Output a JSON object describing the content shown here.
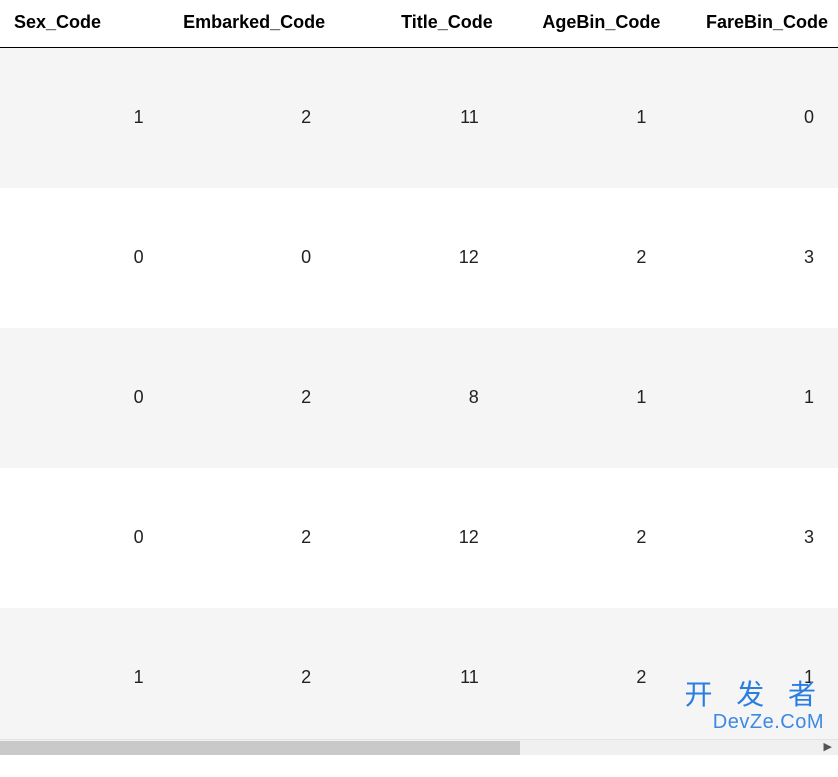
{
  "chart_data": {
    "type": "table",
    "columns": [
      "Sex_Code",
      "Embarked_Code",
      "Title_Code",
      "AgeBin_Code",
      "FareBin_Code"
    ],
    "rows": [
      [
        1,
        2,
        11,
        1,
        0
      ],
      [
        0,
        0,
        12,
        2,
        3
      ],
      [
        0,
        2,
        8,
        1,
        1
      ],
      [
        0,
        2,
        12,
        2,
        3
      ],
      [
        1,
        2,
        11,
        2,
        1
      ]
    ]
  },
  "headers": {
    "c0": "Sex_Code",
    "c1": "Embarked_Code",
    "c2": "Title_Code",
    "c3": "AgeBin_Code",
    "c4": "FareBin_Code"
  },
  "rows": {
    "r0": {
      "c0": "1",
      "c1": "2",
      "c2": "11",
      "c3": "1",
      "c4": "0"
    },
    "r1": {
      "c0": "0",
      "c1": "0",
      "c2": "12",
      "c3": "2",
      "c4": "3"
    },
    "r2": {
      "c0": "0",
      "c1": "2",
      "c2": "8",
      "c3": "1",
      "c4": "1"
    },
    "r3": {
      "c0": "0",
      "c1": "2",
      "c2": "12",
      "c3": "2",
      "c4": "3"
    },
    "r4": {
      "c0": "1",
      "c1": "2",
      "c2": "11",
      "c3": "2",
      "c4": "1"
    }
  },
  "watermark": {
    "line1": "开 发 者",
    "line2": "DevZe.CoM"
  }
}
